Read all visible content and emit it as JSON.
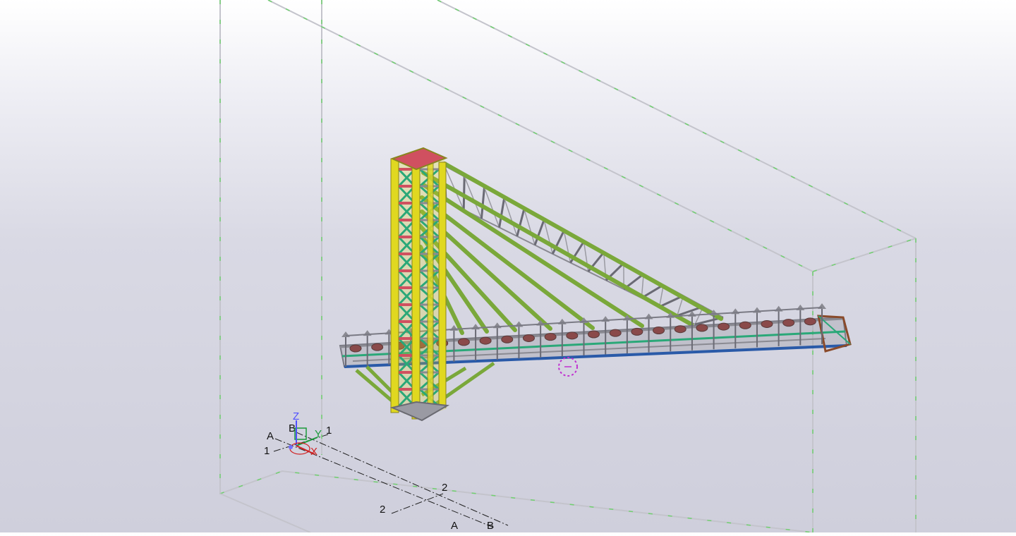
{
  "viewport": {
    "background_top": "#ffffff",
    "background_bottom": "#cfcfdc"
  },
  "gridlines": {
    "labels": [
      "A",
      "B",
      "1",
      "1",
      "2",
      "2",
      "A",
      "B"
    ]
  },
  "axes": {
    "z_label": "Z",
    "y_label": "Y",
    "x_label": "X",
    "z_color": "#5050ff",
    "y_color": "#1a9a3a",
    "x_color": "#d02020"
  },
  "colors": {
    "tower_columns": "#e0d820",
    "tower_bracing": "#2aa878",
    "tower_struts": "#d05060",
    "ropes_green": "#7aa83a",
    "truss_grey": "#8a8a92",
    "gallery_blue": "#2a5aa8",
    "rotation_marker": "#c030d0",
    "work_area_green": "#70d070",
    "work_area_grey": "#c4c4cc"
  },
  "model": {
    "name": "conveyor-gallery-with-tower"
  }
}
